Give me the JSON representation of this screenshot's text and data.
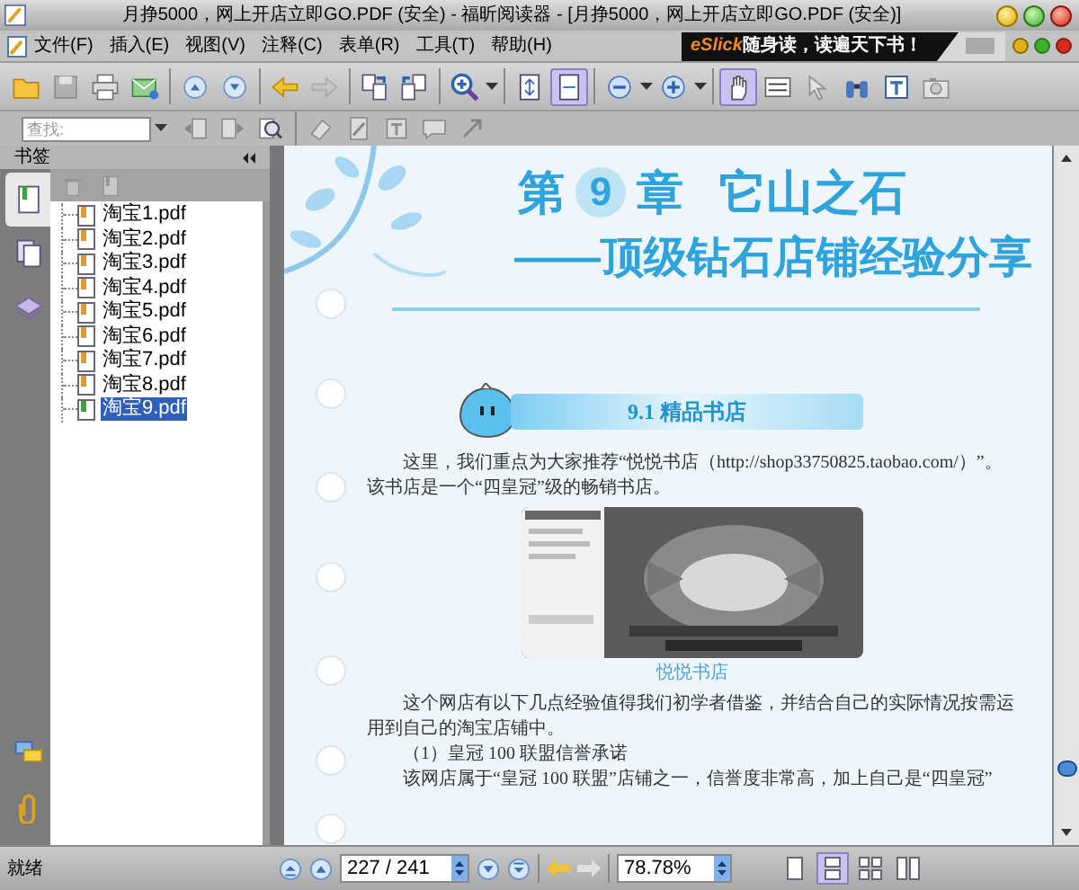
{
  "window": {
    "title": "月挣5000，网上开店立即GO.PDF (安全) - 福昕阅读器 - [月挣5000，网上开店立即GO.PDF (安全)]"
  },
  "menu_bar": {
    "items": [
      "文件(F)",
      "插入(E)",
      "视图(V)",
      "注释(C)",
      "表单(R)",
      "工具(T)",
      "帮助(H)"
    ],
    "banner": {
      "brand": "eSlick",
      "slogan": "随身读，读遍天下书！"
    }
  },
  "toolbar": [
    {
      "kind": "open",
      "disabled": false,
      "selected": false
    },
    {
      "kind": "save",
      "disabled": true,
      "selected": false
    },
    {
      "kind": "print",
      "disabled": false,
      "selected": false
    },
    {
      "kind": "email",
      "disabled": false,
      "selected": false
    },
    {
      "kind": "separator"
    },
    {
      "kind": "previous-page",
      "disabled": false,
      "selected": false
    },
    {
      "kind": "next-page",
      "disabled": false,
      "selected": false
    },
    {
      "kind": "separator"
    },
    {
      "kind": "back",
      "disabled": false,
      "selected": false
    },
    {
      "kind": "forward",
      "disabled": true,
      "selected": false
    },
    {
      "kind": "separator"
    },
    {
      "kind": "insert-page",
      "disabled": false,
      "selected": false
    },
    {
      "kind": "extract-page",
      "disabled": false,
      "selected": false
    },
    {
      "kind": "separator"
    },
    {
      "kind": "zoom-tool",
      "disabled": false,
      "selected": false
    },
    {
      "kind": "dropdown"
    },
    {
      "kind": "separator"
    },
    {
      "kind": "fit-page",
      "disabled": false,
      "selected": false
    },
    {
      "kind": "fit-width",
      "disabled": false,
      "selected": true
    },
    {
      "kind": "separator"
    },
    {
      "kind": "zoom-out",
      "disabled": false,
      "selected": false
    },
    {
      "kind": "dropdown"
    },
    {
      "kind": "zoom-in",
      "disabled": false,
      "selected": false
    },
    {
      "kind": "dropdown"
    },
    {
      "kind": "separator"
    },
    {
      "kind": "hand",
      "disabled": false,
      "selected": true
    },
    {
      "kind": "select-text",
      "disabled": false,
      "selected": false
    },
    {
      "kind": "pointer",
      "disabled": true,
      "selected": false
    },
    {
      "kind": "binoculars",
      "disabled": false,
      "selected": false
    },
    {
      "kind": "typewriter",
      "disabled": false,
      "selected": false
    },
    {
      "kind": "snapshot",
      "disabled": true,
      "selected": false
    }
  ],
  "find_toolbar": {
    "search": {
      "placeholder": "查找:"
    },
    "tools": [
      {
        "kind": "find-previous",
        "disabled": true
      },
      {
        "kind": "find-next",
        "disabled": true
      },
      {
        "kind": "search",
        "disabled": false
      },
      {
        "kind": "separator"
      },
      {
        "kind": "eraser",
        "disabled": true
      },
      {
        "kind": "pencil",
        "disabled": true
      },
      {
        "kind": "typewriter",
        "disabled": true
      },
      {
        "kind": "note",
        "disabled": true
      },
      {
        "kind": "arrow",
        "disabled": true
      }
    ]
  },
  "sidebar": {
    "title": "书签",
    "tabs": [
      {
        "kind": "bookmarks",
        "selected": true
      },
      {
        "kind": "pages",
        "selected": false
      },
      {
        "kind": "layers",
        "selected": false
      },
      {
        "kind": "comments",
        "selected": false
      },
      {
        "kind": "attachments",
        "selected": false
      }
    ],
    "tools": [
      {
        "kind": "delete",
        "disabled": true
      },
      {
        "kind": "add-bookmark",
        "disabled": true
      }
    ],
    "bookmarks": [
      {
        "label": "淘宝1.pdf",
        "selected": false,
        "color": "#e09a2a"
      },
      {
        "label": "淘宝2.pdf",
        "selected": false,
        "color": "#e09a2a"
      },
      {
        "label": "淘宝3.pdf",
        "selected": false,
        "color": "#e09a2a"
      },
      {
        "label": "淘宝4.pdf",
        "selected": false,
        "color": "#e09a2a"
      },
      {
        "label": "淘宝5.pdf",
        "selected": false,
        "color": "#e09a2a"
      },
      {
        "label": "淘宝6.pdf",
        "selected": false,
        "color": "#e09a2a"
      },
      {
        "label": "淘宝7.pdf",
        "selected": false,
        "color": "#e09a2a"
      },
      {
        "label": "淘宝8.pdf",
        "selected": false,
        "color": "#e09a2a"
      },
      {
        "label": "淘宝9.pdf",
        "selected": true,
        "color": "#3aa63a"
      }
    ]
  },
  "document": {
    "chapter_prefix": "第",
    "chapter_number": "9",
    "chapter_suffix": "章",
    "chapter_title": "它山之石",
    "subtitle": "——顶级钻石店铺经验分享",
    "section_title": "9.1 精品书店",
    "blocks": [
      {
        "kind": "paragraph",
        "text": "这里，我们重点为大家推荐“悦悦书店（http://shop33750825.taobao.com/）”。该书店是一个“四皇冠”级的畅销书店。"
      },
      {
        "kind": "figure",
        "caption": "悦悦书店"
      },
      {
        "kind": "paragraph",
        "text": "这个网店有以下几点经验值得我们初学者借鉴，并结合自己的实际情况按需运用到自己的淘宝店铺中。"
      },
      {
        "kind": "item",
        "text": "（1）皇冠 100 联盟信誉承诺"
      },
      {
        "kind": "paragraph",
        "text": "该网店属于“皇冠 100 联盟”店铺之一，信誉度非常高，加上自己是“四皇冠”"
      }
    ]
  },
  "status_bar": {
    "status": "就绪",
    "page": "227 / 241",
    "zoom": "78.78%",
    "view_modes": [
      {
        "kind": "single-page",
        "selected": false
      },
      {
        "kind": "continuous",
        "selected": true
      },
      {
        "kind": "facing",
        "selected": false
      },
      {
        "kind": "continuous-facing",
        "selected": false
      }
    ]
  }
}
